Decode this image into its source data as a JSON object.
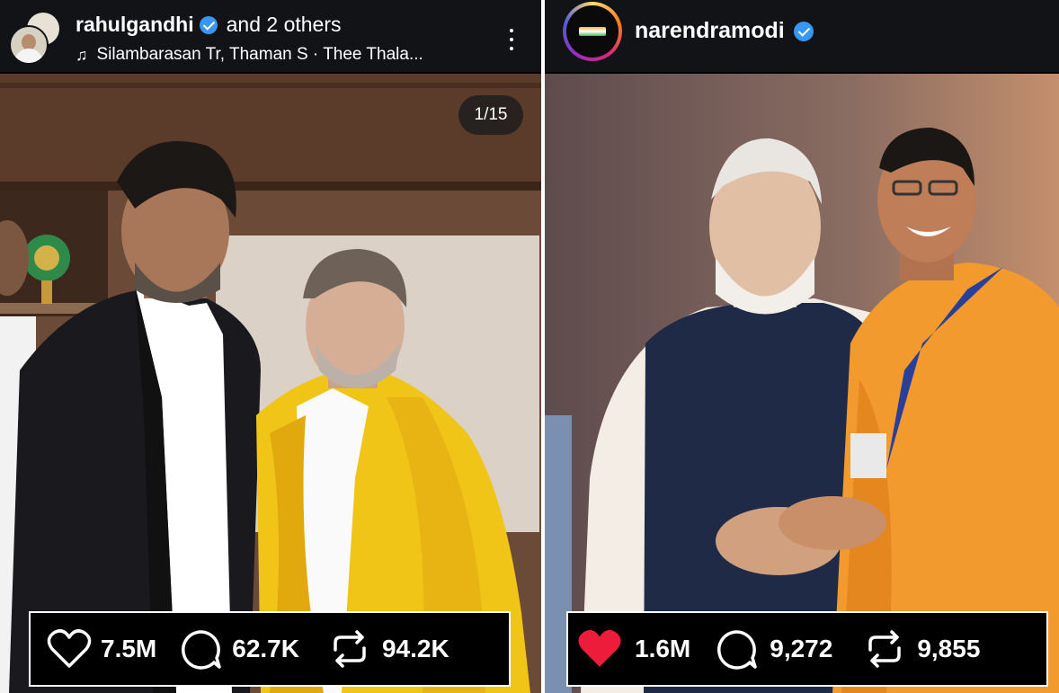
{
  "left_post": {
    "username": "rahulgandhi",
    "collab_text": "and 2 others",
    "music": "Silambarasan Tr, Thaman S · Thee Thala...",
    "carousel_counter": "1/15",
    "likes": "7.5M",
    "comments": "62.7K",
    "reposts": "94.2K"
  },
  "right_post": {
    "username": "narendramodi",
    "likes": "1.6M",
    "comments": "9,272",
    "reposts": "9,855"
  },
  "colors": {
    "verified": "#3897f0",
    "liked_heart": "#ed1c3a",
    "header_bg": "#111317"
  },
  "icons": [
    "verified-badge-icon",
    "music-note-icon",
    "more-options-icon",
    "heart-icon",
    "comment-icon",
    "repost-icon"
  ]
}
